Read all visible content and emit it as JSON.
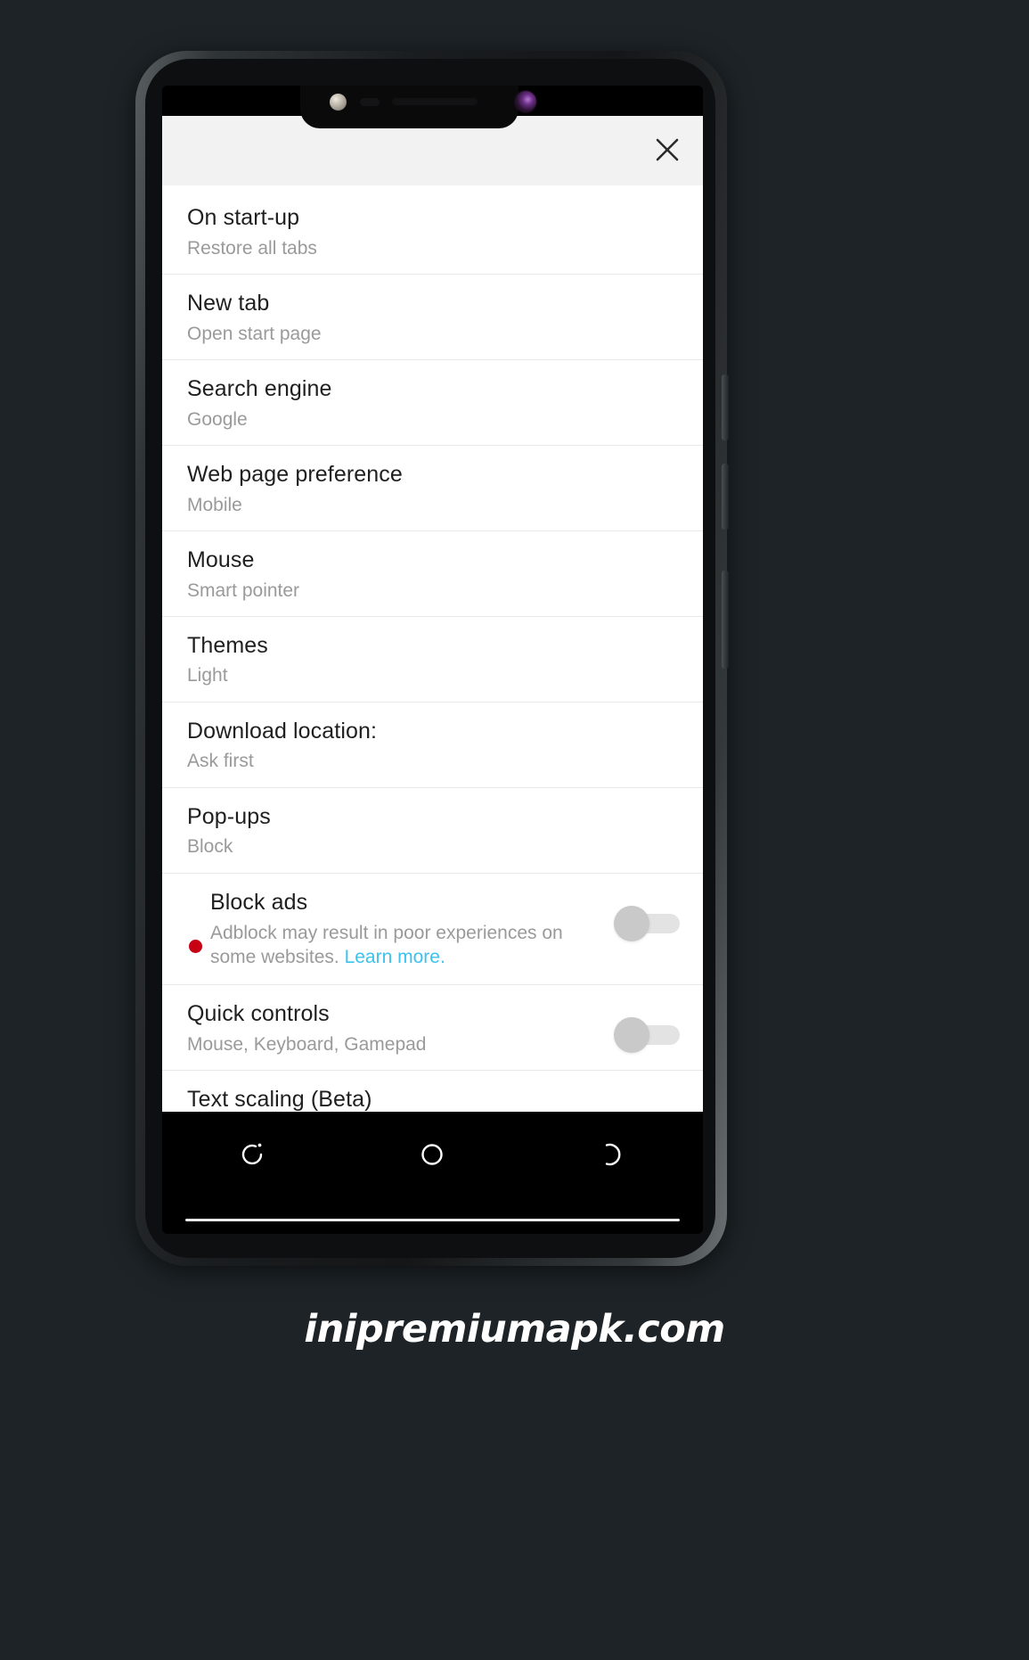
{
  "watermark": {
    "text": "inipremiumapk.com"
  },
  "device": {
    "notch": {
      "sensor_icon": "proximity-sensor-icon",
      "speaker_icon": "speaker-grill-icon",
      "earpiece_icon": "earpiece-icon",
      "camera_icon": "front-camera-icon"
    },
    "side_buttons": [
      "volume-up",
      "volume-down",
      "power"
    ]
  },
  "panel": {
    "close_icon": "close-icon",
    "close_label": "✕"
  },
  "settings": [
    {
      "title": "On start-up",
      "value": "Restore all tabs"
    },
    {
      "title": "New tab",
      "value": "Open start page"
    },
    {
      "title": "Search engine",
      "value": "Google"
    },
    {
      "title": "Web page preference",
      "value": "Mobile"
    },
    {
      "title": "Mouse",
      "value": "Smart pointer"
    },
    {
      "title": "Themes",
      "value": "Light"
    },
    {
      "title": "Download location:",
      "value": "Ask first"
    },
    {
      "title": "Pop-ups",
      "value": "Block"
    }
  ],
  "toggles": [
    {
      "title": "Block ads",
      "description": "Adblock may result in poor experiences on some websites.",
      "link_text": "Learn more.",
      "has_warning_dot": true,
      "warning_dot_color": "#c70014",
      "link_color": "#3cc2ef",
      "state": "off"
    },
    {
      "title": "Quick controls",
      "description": "Mouse, Keyboard, Gamepad",
      "has_warning_dot": false,
      "state": "off"
    }
  ],
  "partial_row": {
    "title": "Text scaling (Beta)"
  },
  "navbar": {
    "items": [
      {
        "name": "recent-apps-button",
        "icon": "recent-apps-icon"
      },
      {
        "name": "home-button",
        "icon": "home-circle-icon"
      },
      {
        "name": "back-button",
        "icon": "back-icon"
      }
    ]
  },
  "colors": {
    "header_bg": "#f2f2f2",
    "panel_bg": "#ffffff",
    "title_text": "#1f1f1f",
    "value_text": "#9a9a9a",
    "divider": "#e8e8e8",
    "backdrop": "#1d2327"
  }
}
